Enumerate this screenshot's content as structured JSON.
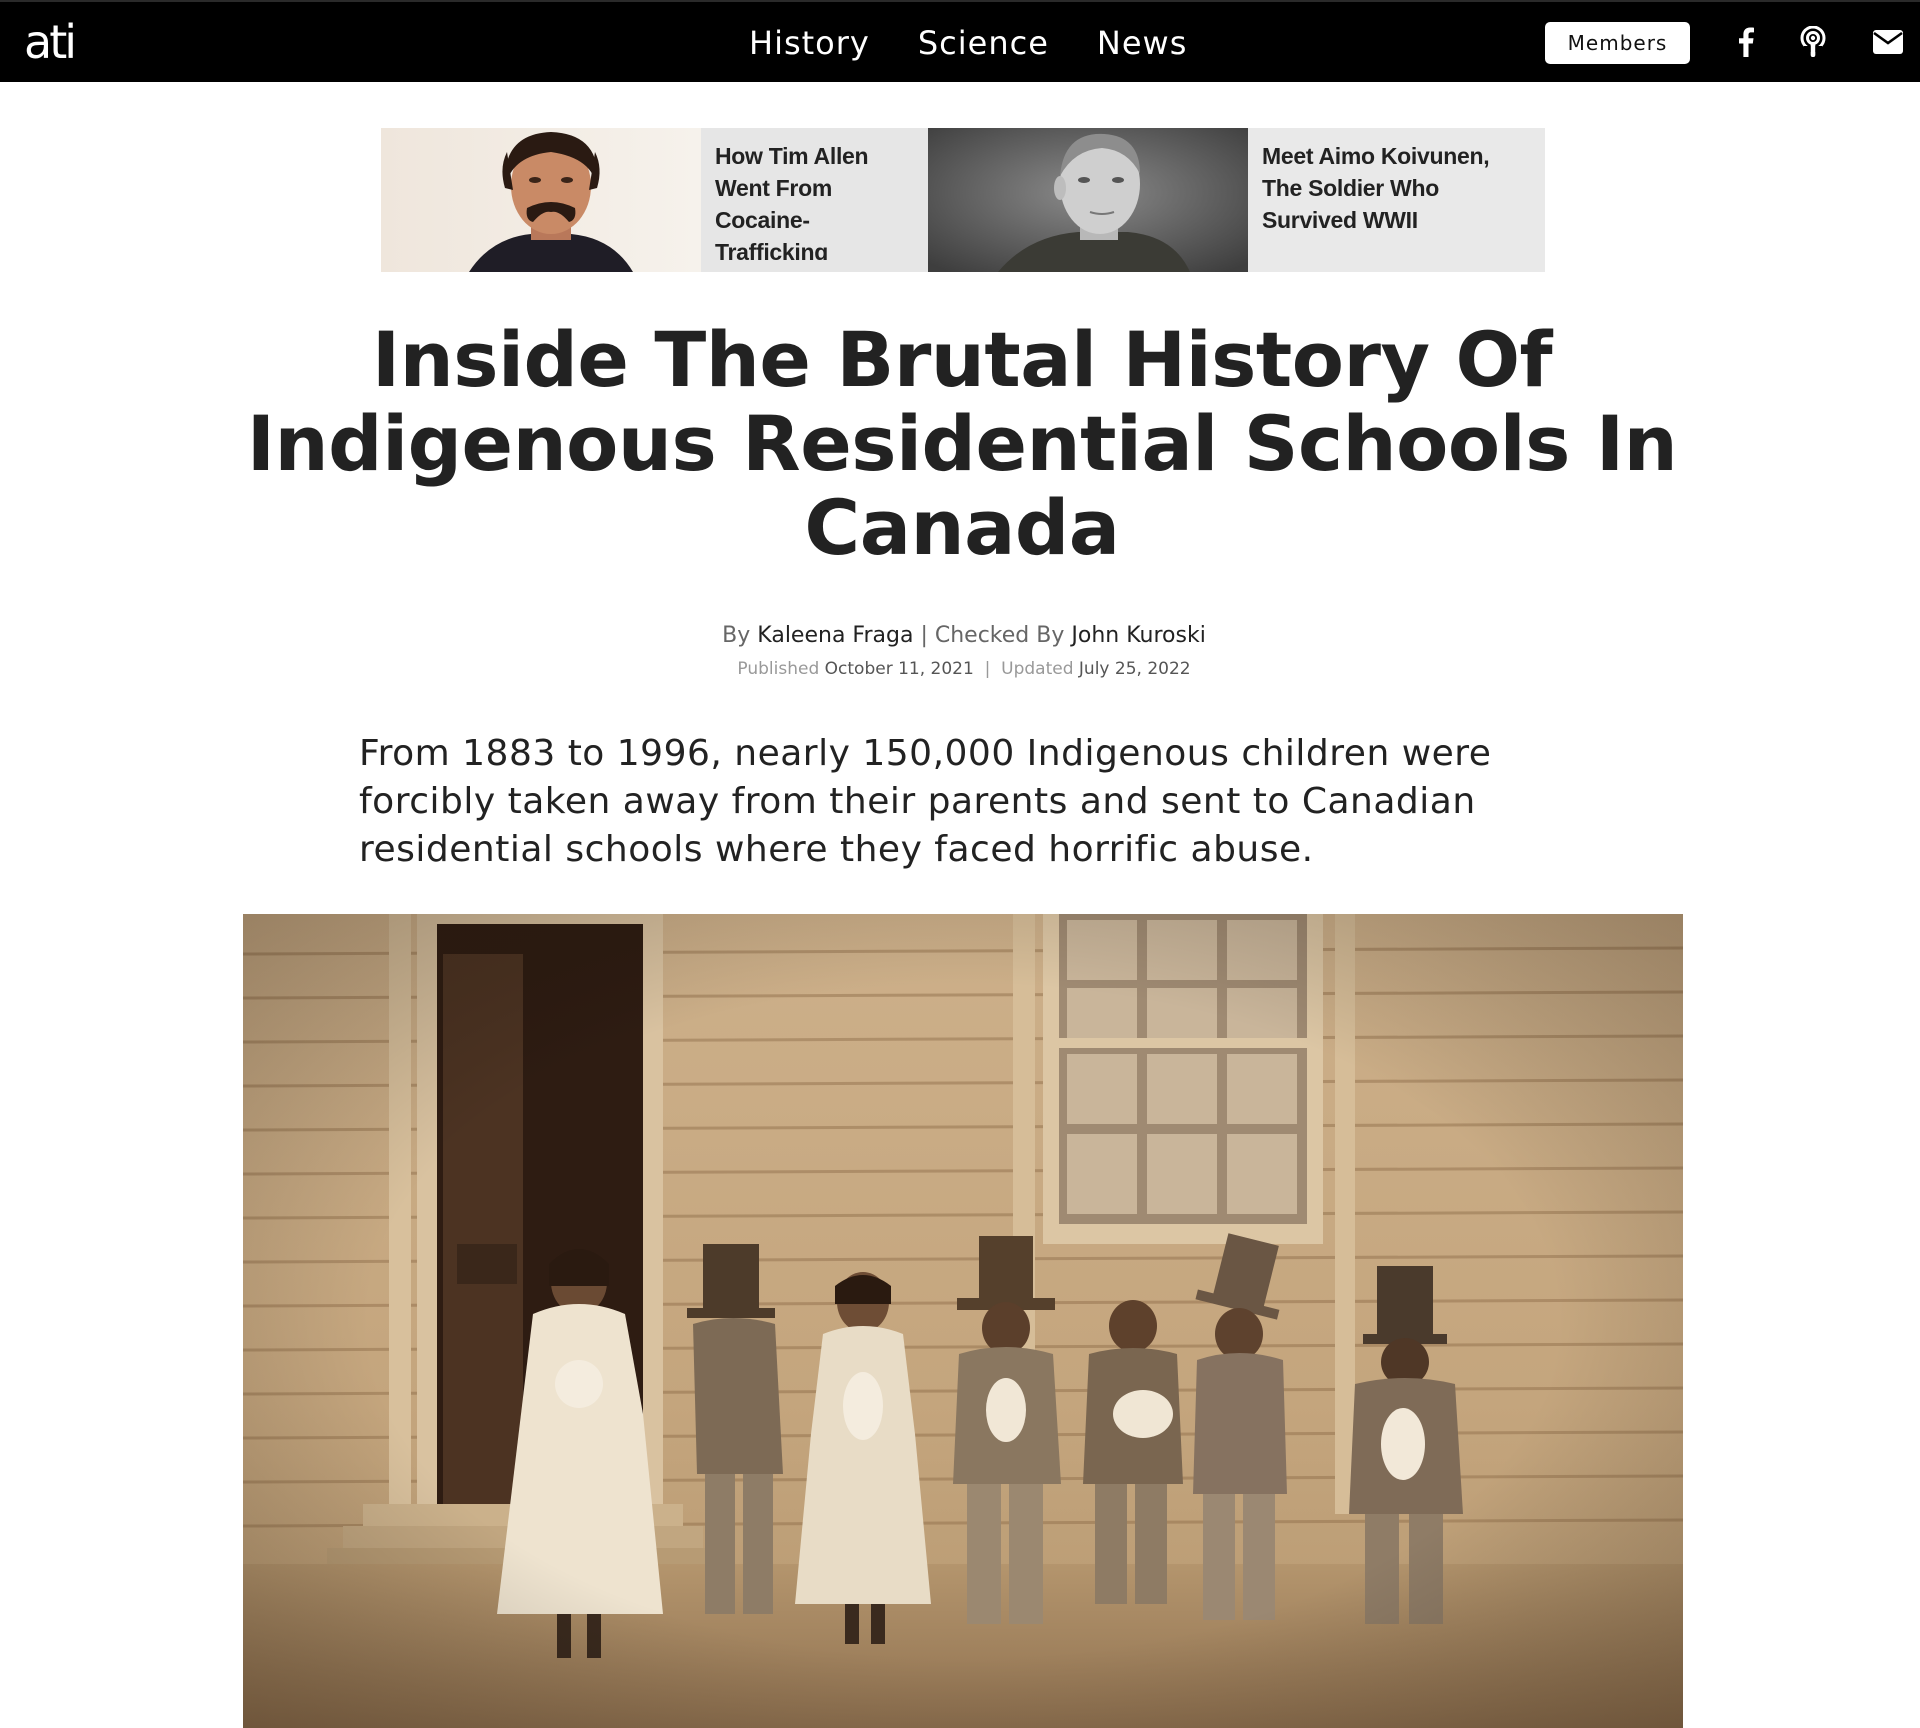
{
  "site": {
    "logo_text": "ati"
  },
  "nav": {
    "items": [
      "History",
      "Science",
      "News"
    ]
  },
  "header_actions": {
    "members_label": "Members",
    "icons": [
      "facebook-icon",
      "podcast-icon",
      "email-icon"
    ]
  },
  "related": [
    {
      "title": "How Tim Allen Went From Cocaine-Trafficking Criminal To ‘Home"
    },
    {
      "title": "Meet Aimo Koivunen, The Soldier Who Survived WWII"
    }
  ],
  "article": {
    "headline": "Inside The Brutal History Of Indigenous Residential Schools In Canada",
    "byline": {
      "by_prefix": "By",
      "author": "Kaleena Fraga",
      "separator": "|",
      "checked_prefix": "Checked By",
      "checker": "John Kuroski"
    },
    "dates": {
      "published_prefix": "Published",
      "published": "October 11, 2021",
      "separator": "|",
      "updated_prefix": "Updated",
      "updated": "July 25, 2022"
    },
    "dek": "From 1883 to 1996, nearly 150,000 Indigenous children were forcibly taken away from their parents and sent to Canadian residential schools where they faced horrific abuse."
  },
  "colors": {
    "topbar_bg": "#000000",
    "headline": "#222222",
    "sepia_light": "#d9c4a3",
    "sepia_dark": "#3a2b1e"
  }
}
